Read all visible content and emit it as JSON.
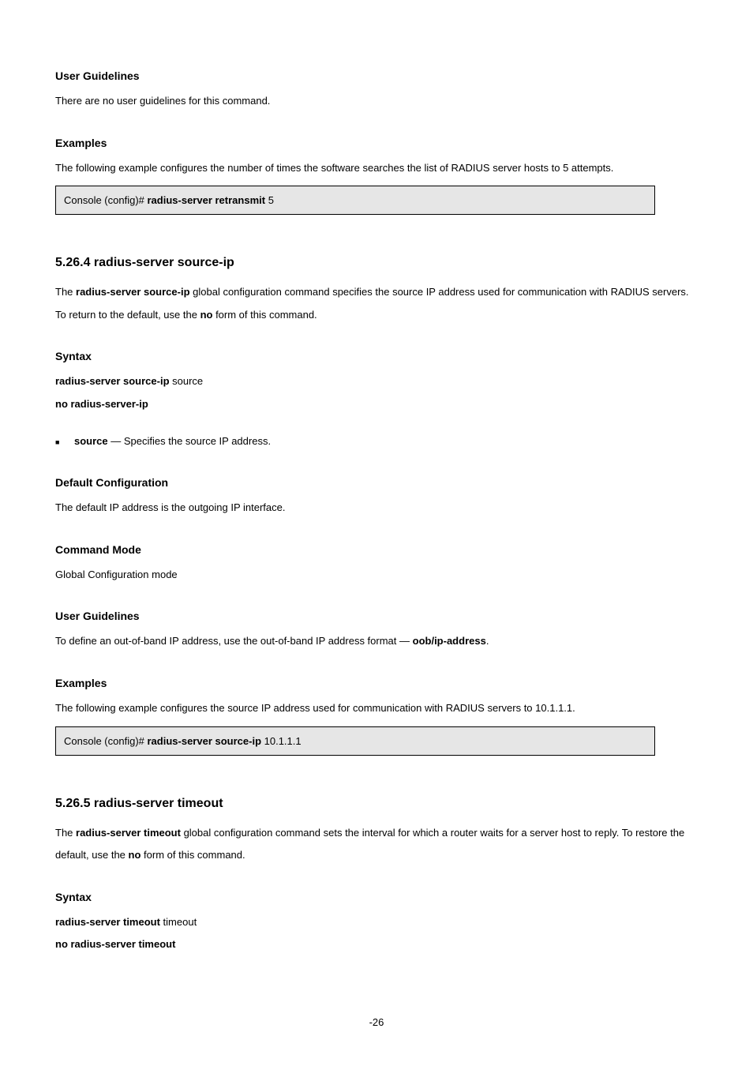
{
  "s1": {
    "heading": "User Guidelines",
    "body": "There are no user guidelines for this command."
  },
  "s2": {
    "heading": "Examples",
    "body": "The following example configures the number of times the software searches the list of RADIUS server hosts to 5 attempts.",
    "code": {
      "prompt": "Console (config)# ",
      "cmd": "radius-server retransmit ",
      "arg": "5"
    }
  },
  "cmd2": {
    "title": "5.26.4 radius-server source-ip",
    "desc_pre": "The ",
    "desc_bold1": "radius-server source-ip",
    "desc_mid": " global configuration command specifies the source IP address used for communication with RADIUS servers. To return to the default, use the ",
    "desc_bold2": "no",
    "desc_post": " form of this command."
  },
  "syntax2": {
    "heading": "Syntax",
    "l1a": "radius-server source-ip ",
    "l1b": "source",
    "l2": "no radius-server-ip",
    "bullet_bold": "source",
    "bullet_rest": " — Specifies the source IP address."
  },
  "def2": {
    "heading": "Default Configuration",
    "body": "The default IP address is the outgoing IP interface."
  },
  "mode2": {
    "heading": "Command Mode",
    "body": "Global Configuration mode"
  },
  "ug2": {
    "heading": "User Guidelines",
    "body_pre": "To define an out-of-band IP address, use the out-of-band IP address format — ",
    "body_bold": "oob/ip-address",
    "body_post": "."
  },
  "ex2": {
    "heading": "Examples",
    "body": "The following example configures the source IP address used for communication with RADIUS servers to 10.1.1.1.",
    "code": {
      "prompt": "Console (config)# ",
      "cmd": "radius-server source-ip ",
      "arg": "10.1.1.1"
    }
  },
  "cmd3": {
    "title": "5.26.5 radius-server timeout",
    "desc_pre": "The ",
    "desc_bold1": "radius-server timeout",
    "desc_mid": " global configuration command sets the interval for which a router waits for a server host to reply. To restore the default, use the ",
    "desc_bold2": "no",
    "desc_post": " form of this command."
  },
  "syntax3": {
    "heading": "Syntax",
    "l1a": "radius-server timeout ",
    "l1b": "timeout",
    "l2": "no radius-server timeout"
  },
  "footer": {
    "page": "-26"
  }
}
